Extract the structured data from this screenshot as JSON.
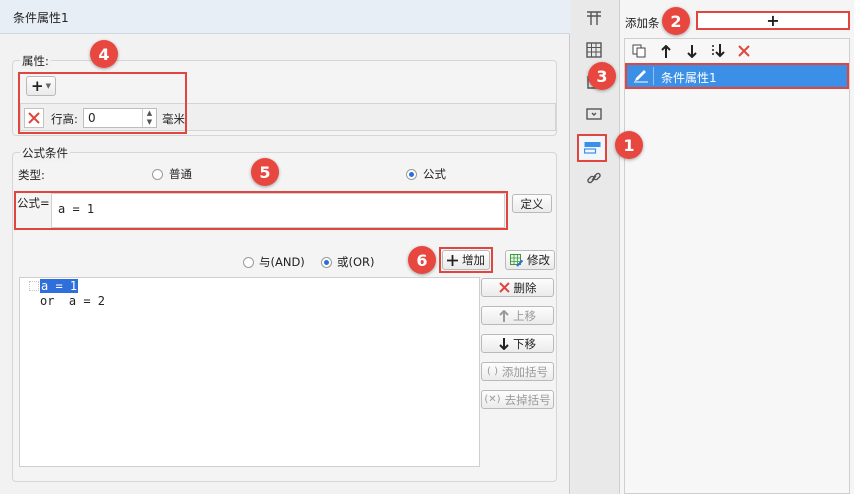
{
  "dialog": {
    "title": "条件属性1",
    "properties": {
      "legend": "属性:",
      "add_label": "+",
      "row_height_label": "行高:",
      "row_height_value": "0",
      "unit": "毫米"
    },
    "formula_condition": {
      "legend": "公式条件",
      "type_label": "类型:",
      "options": [
        "普通",
        "公式"
      ],
      "selected": "公式",
      "formula_label": "公式=",
      "formula_value": "a = 1",
      "define_button": "定义",
      "logic_options": [
        "与(AND)",
        "或(OR)"
      ],
      "logic_selected": "或(OR)",
      "add_button": "增加",
      "modify_button": "修改",
      "conditions": [
        "a = 1",
        "or  a = 2"
      ],
      "side_buttons": {
        "delete": "删除",
        "move_up": "上移",
        "move_down": "下移",
        "add_bracket": "添加括号",
        "remove_bracket": "去掉括号"
      }
    }
  },
  "right_panel": {
    "add_condition_label": "添加条",
    "add_button_label": "+",
    "list_items": [
      "条件属性1"
    ]
  },
  "callouts": [
    "1",
    "2",
    "3",
    "4",
    "5",
    "6"
  ],
  "colors": {
    "accent_blue": "#3b8fe6",
    "callout_red": "#e8473f",
    "delete_red": "#e0453e"
  }
}
